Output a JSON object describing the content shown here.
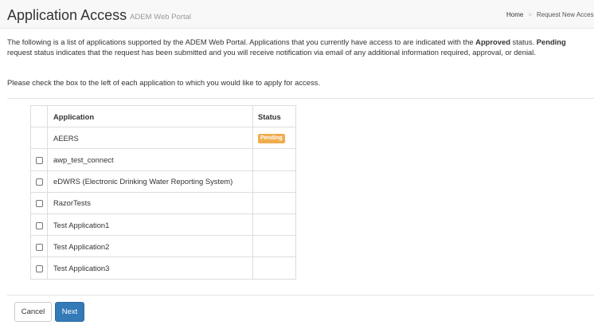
{
  "header": {
    "title": "Application Access",
    "subtitle": "ADEM Web Portal",
    "breadcrumb": {
      "home": "Home",
      "separator": ">",
      "current": "Request New Access"
    }
  },
  "intro": {
    "part1": "The following is a list of applications supported by the ADEM Web Portal. Applications that you currently have access to are indicated with the ",
    "approved_word": "Approved",
    "part2": " status. ",
    "pending_word": "Pending",
    "part3": " request status indicates that the request has been submitted and you will receive notification via email of any additional information required, approval, or denial."
  },
  "instruction": "Please check the box to the left of each application to which you would like to apply for access.",
  "table": {
    "headers": {
      "application": "Application",
      "status": "Status"
    },
    "rows": [
      {
        "name": "AEERS",
        "status": "Pending",
        "checkbox": false
      },
      {
        "name": "awp_test_connect",
        "status": "",
        "checkbox": true
      },
      {
        "name": "eDWRS (Electronic Drinking Water Reporting System)",
        "status": "",
        "checkbox": true
      },
      {
        "name": "RazorTests",
        "status": "",
        "checkbox": true
      },
      {
        "name": "Test Application1",
        "status": "",
        "checkbox": true
      },
      {
        "name": "Test Application2",
        "status": "",
        "checkbox": true
      },
      {
        "name": "Test Application3",
        "status": "",
        "checkbox": true
      }
    ]
  },
  "buttons": {
    "cancel": "Cancel",
    "next": "Next"
  },
  "colors": {
    "pending_badge": "#f0ad4e",
    "primary_button": "#337ab7",
    "header_bg": "#f8f8f8"
  }
}
